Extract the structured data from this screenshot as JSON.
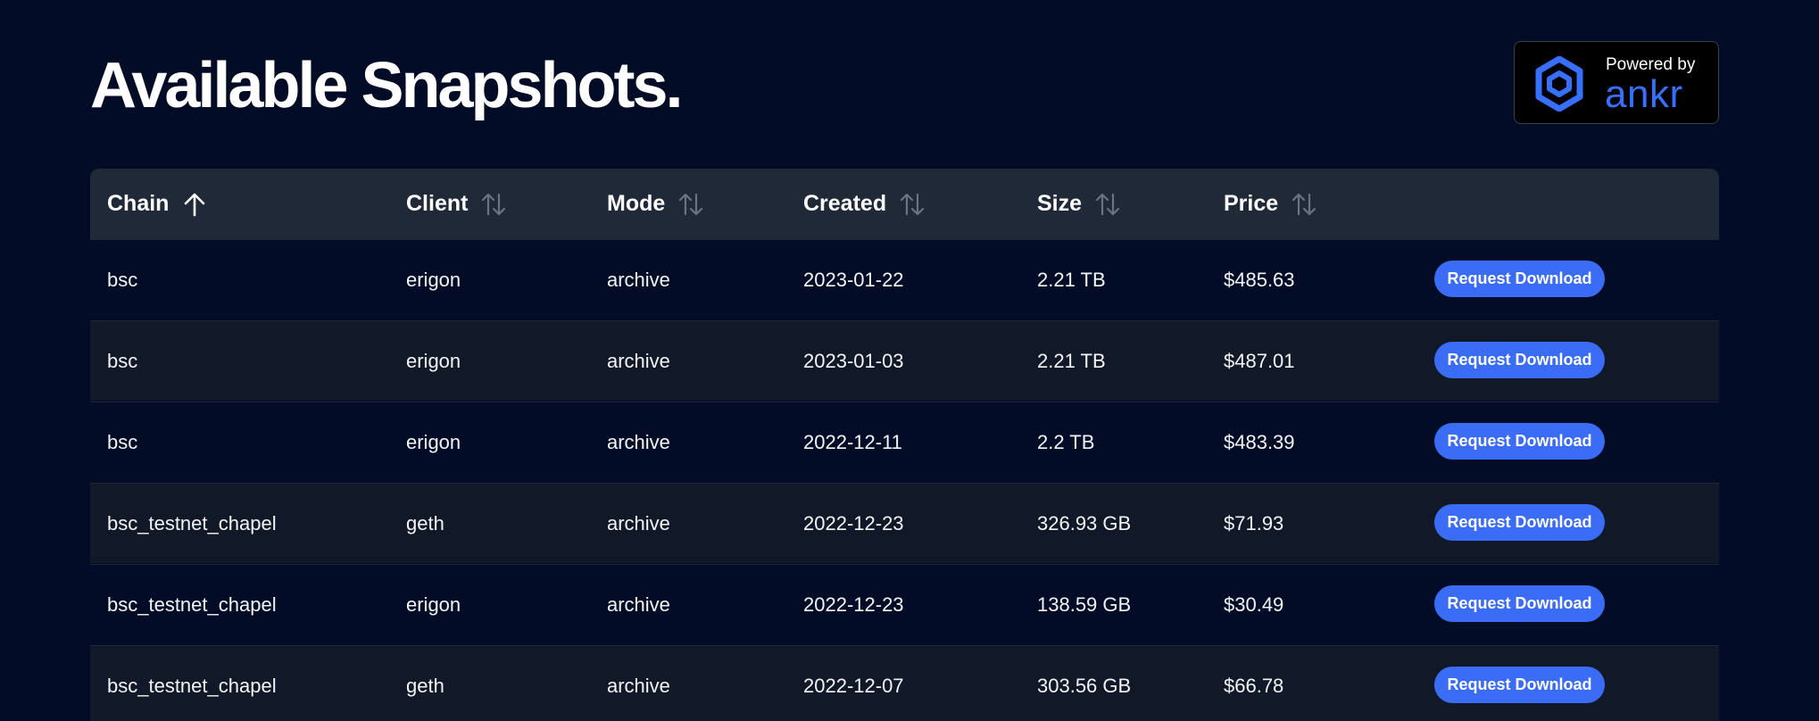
{
  "page": {
    "title": "Available Snapshots."
  },
  "badge": {
    "powered_by": "Powered by",
    "brand": "ankr",
    "icon": "ankr-logo-icon"
  },
  "colors": {
    "background": "#020c26",
    "header_row": "#1f2937",
    "stripe_row": "#111827",
    "accent": "#3b6cf6",
    "brand": "#3770ff"
  },
  "table": {
    "columns": [
      {
        "label": "Chain",
        "sort": "ascending",
        "icon": "arrow-up-icon"
      },
      {
        "label": "Client",
        "sort": "none",
        "icon": "sort-icon"
      },
      {
        "label": "Mode",
        "sort": "none",
        "icon": "sort-icon"
      },
      {
        "label": "Created",
        "sort": "none",
        "icon": "sort-icon"
      },
      {
        "label": "Size",
        "sort": "none",
        "icon": "sort-icon"
      },
      {
        "label": "Price",
        "sort": "none",
        "icon": "sort-icon"
      }
    ],
    "action_label": "Request Download",
    "rows": [
      {
        "chain": "bsc",
        "client": "erigon",
        "mode": "archive",
        "created": "2023-01-22",
        "size": "2.21 TB",
        "price": "$485.63"
      },
      {
        "chain": "bsc",
        "client": "erigon",
        "mode": "archive",
        "created": "2023-01-03",
        "size": "2.21 TB",
        "price": "$487.01"
      },
      {
        "chain": "bsc",
        "client": "erigon",
        "mode": "archive",
        "created": "2022-12-11",
        "size": "2.2 TB",
        "price": "$483.39"
      },
      {
        "chain": "bsc_testnet_chapel",
        "client": "geth",
        "mode": "archive",
        "created": "2022-12-23",
        "size": "326.93 GB",
        "price": "$71.93"
      },
      {
        "chain": "bsc_testnet_chapel",
        "client": "erigon",
        "mode": "archive",
        "created": "2022-12-23",
        "size": "138.59 GB",
        "price": "$30.49"
      },
      {
        "chain": "bsc_testnet_chapel",
        "client": "geth",
        "mode": "archive",
        "created": "2022-12-07",
        "size": "303.56 GB",
        "price": "$66.78"
      }
    ]
  }
}
